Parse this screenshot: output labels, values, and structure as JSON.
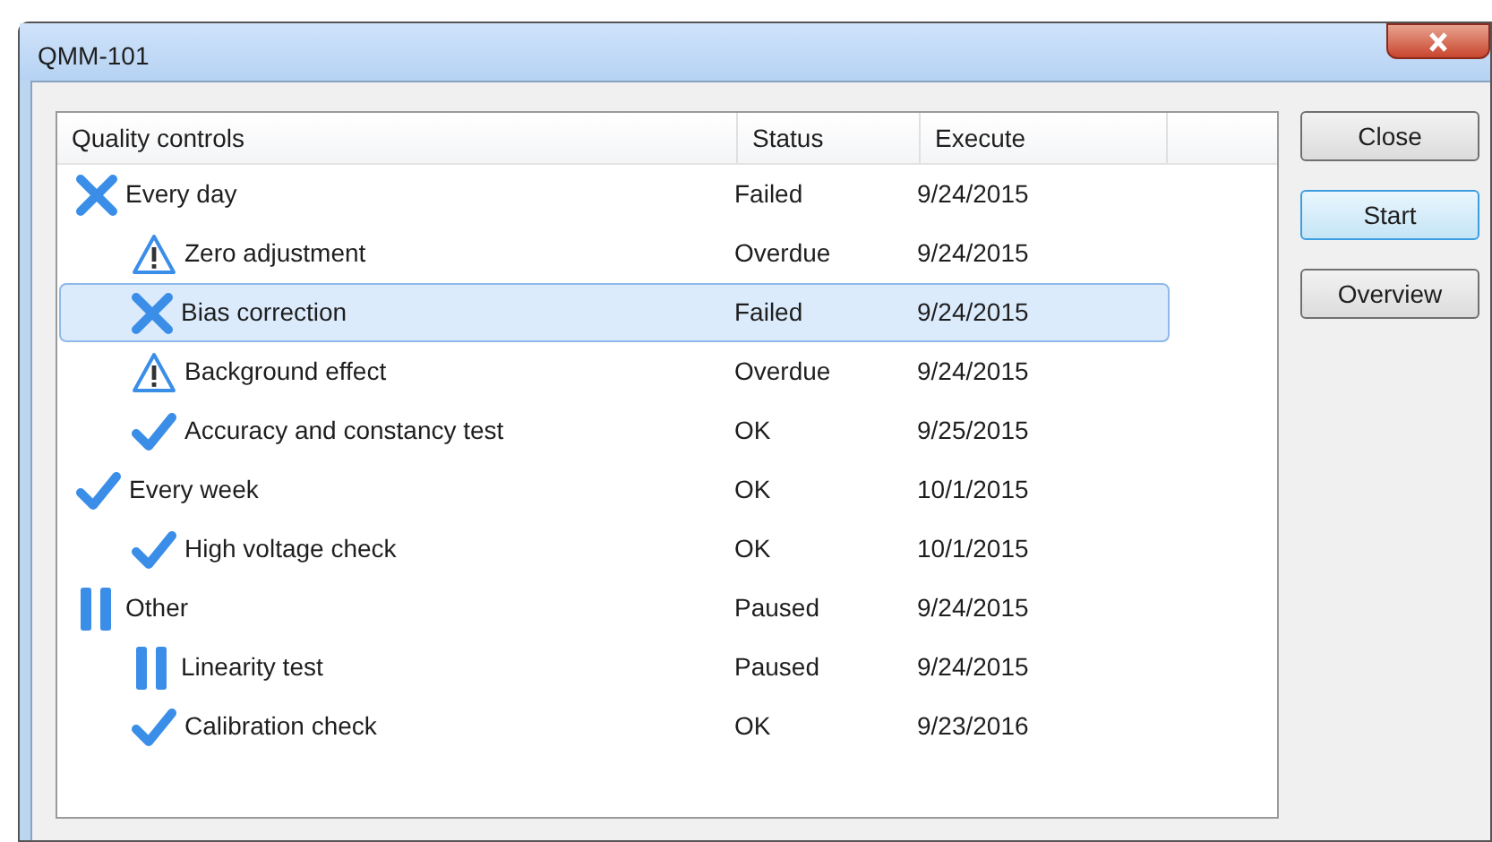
{
  "window": {
    "title": "QMM-101"
  },
  "table": {
    "columns": [
      "Quality controls",
      "Status",
      "Execute"
    ],
    "rows": [
      {
        "name": "Every day",
        "kind": "failed",
        "status": "Failed",
        "execute": "9/24/2015",
        "selected": false,
        "children": [
          {
            "name": "Zero adjustment",
            "kind": "warning",
            "status": "Overdue",
            "execute": "9/24/2015",
            "selected": false
          },
          {
            "name": "Bias correction",
            "kind": "failed",
            "status": "Failed",
            "execute": "9/24/2015",
            "selected": true
          },
          {
            "name": "Background effect",
            "kind": "warning",
            "status": "Overdue",
            "execute": "9/24/2015",
            "selected": false
          },
          {
            "name": "Accuracy and constancy test",
            "kind": "ok",
            "status": "OK",
            "execute": "9/25/2015",
            "selected": false
          }
        ]
      },
      {
        "name": "Every week",
        "kind": "ok",
        "status": "OK",
        "execute": "10/1/2015",
        "selected": false,
        "children": [
          {
            "name": "High voltage check",
            "kind": "ok",
            "status": "OK",
            "execute": "10/1/2015",
            "selected": false
          }
        ]
      },
      {
        "name": "Other",
        "kind": "paused",
        "status": "Paused",
        "execute": "9/24/2015",
        "selected": false,
        "children": [
          {
            "name": "Linearity test",
            "kind": "paused",
            "status": "Paused",
            "execute": "9/24/2015",
            "selected": false
          },
          {
            "name": "Calibration check",
            "kind": "ok",
            "status": "OK",
            "execute": "9/23/2016",
            "selected": false
          }
        ]
      }
    ]
  },
  "buttons": [
    {
      "label": "Close",
      "default": false
    },
    {
      "label": "Start",
      "default": true
    },
    {
      "label": "Overview",
      "default": false
    }
  ]
}
